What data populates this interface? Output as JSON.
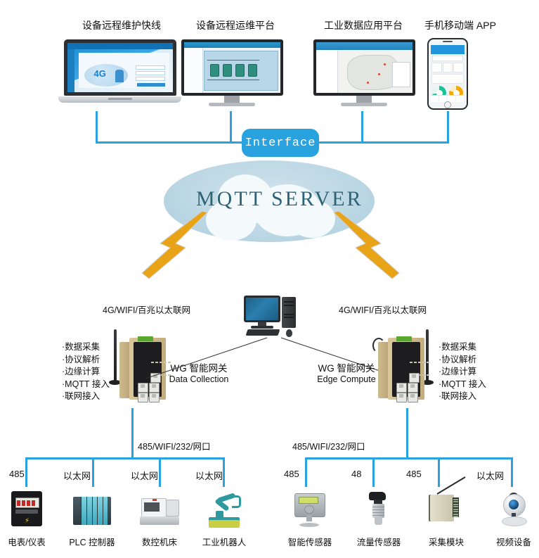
{
  "top_clients": [
    {
      "label": "设备远程维护快线",
      "device": "laptop",
      "icon": "laptop-icon"
    },
    {
      "label": "设备远程运维平台",
      "device": "monitor",
      "icon": "monitor-icon"
    },
    {
      "label": "工业数据应用平台",
      "device": "monitor",
      "icon": "monitor-icon"
    },
    {
      "label": "手机移动端 APP",
      "device": "phone",
      "icon": "smartphone-icon"
    }
  ],
  "interface": {
    "label": "Interface"
  },
  "cloud": {
    "label": "MQTT SERVER"
  },
  "gateways": [
    {
      "network_label": "4G/WIFI/百兆以太联网",
      "name_cn": "WG 智能网关",
      "name_en": "Data Collection",
      "features": [
        "·数据采集",
        "·协议解析",
        "·边缘计算",
        "·MQTT 接入",
        "·联网接入"
      ],
      "bus_label": "485/WIFI/232/网口"
    },
    {
      "network_label": "4G/WIFI/百兆以太联网",
      "name_cn": "WG 智能网关",
      "name_en": "Edge Compute",
      "features": [
        "·数据采集",
        "·协议解析",
        "·边缘计算",
        "·MQTT 接入",
        "·联网接入"
      ],
      "bus_label": "485/WIFI/232/网口"
    }
  ],
  "pc": {
    "icon": "desktop-computer-icon"
  },
  "left_devices": [
    {
      "link": "485",
      "label": "电表/仪表",
      "icon": "electric-meter-icon"
    },
    {
      "link": "以太网",
      "label": "PLC 控制器",
      "icon": "plc-controller-icon"
    },
    {
      "link": "以太网",
      "label": "数控机床",
      "icon": "cnc-machine-icon"
    },
    {
      "link": "以太网",
      "label": "工业机器人",
      "icon": "industrial-robot-icon"
    }
  ],
  "right_devices": [
    {
      "link": "485",
      "label": "智能传感器",
      "icon": "smart-sensor-icon"
    },
    {
      "link": "48",
      "label": "流量传感器",
      "icon": "flow-sensor-icon"
    },
    {
      "link": "485",
      "label": "采集模块",
      "icon": "acquisition-module-icon"
    },
    {
      "link": "以太网",
      "label": "视频设备",
      "icon": "video-camera-icon"
    }
  ],
  "colors": {
    "link_blue": "#29a3df",
    "cloud_fill": "#bcd7e4",
    "cloud_text": "#2e6275",
    "bolt_gold": "#e8a317"
  }
}
